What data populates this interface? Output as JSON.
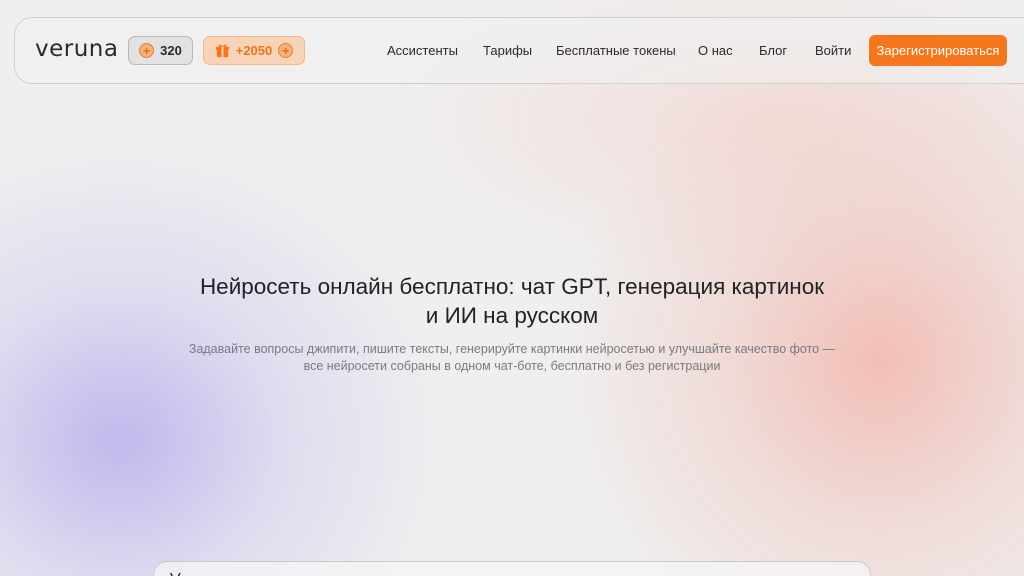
{
  "header": {
    "logo": "veruna",
    "token_badge": {
      "icon": "plus-circle-icon",
      "value": "320"
    },
    "bonus_badge": {
      "icon": "gift-icon",
      "value": "+2050",
      "trailing_icon": "plus-circle-icon"
    },
    "nav": [
      {
        "label": "Ассистенты"
      },
      {
        "label": "Тарифы"
      },
      {
        "label": "Бесплатные токены"
      },
      {
        "label": "О нас"
      },
      {
        "label": "Блог"
      },
      {
        "label": "Войти"
      }
    ],
    "register_label": "Зарегистрироваться"
  },
  "hero": {
    "title_line1": "Нейросеть онлайн бесплатно: чат GPT, генерация картинок",
    "title_line2": "и ИИ на русском",
    "subtitle_line1": "Задавайте вопросы джипити, пишите тексты, генерируйте картинки нейросетью и улучшайте качество фото —",
    "subtitle_line2": "все нейросети собраны в одном чат-боте, бесплатно и без регистрации"
  },
  "chat": {
    "partial_text": "V"
  },
  "colors": {
    "accent": "#f5761c",
    "bonus_bg": "#f7d3b8",
    "bonus_text": "#ec7320"
  }
}
